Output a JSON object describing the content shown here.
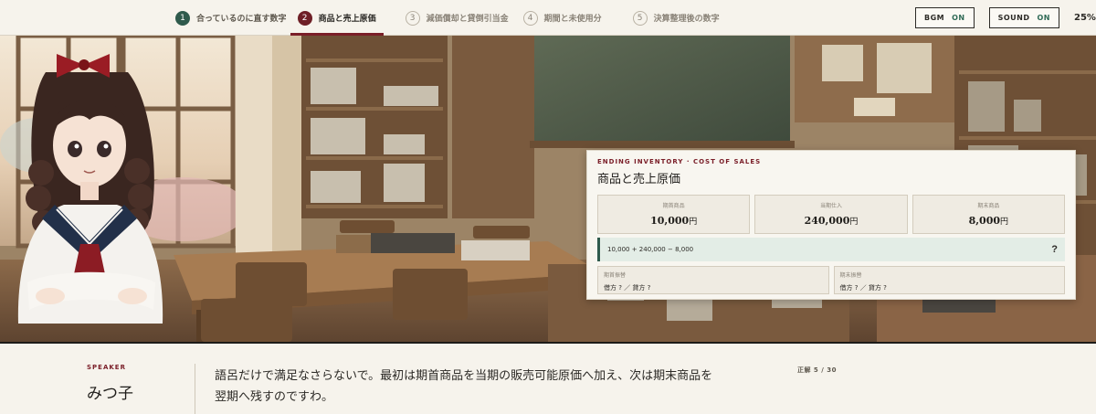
{
  "steps": [
    {
      "num": "1",
      "label": "合っているのに直す数字"
    },
    {
      "num": "2",
      "label": "商品と売上原価"
    },
    {
      "num": "3",
      "label": "減価償却と貸倒引当金"
    },
    {
      "num": "4",
      "label": "期間と未使用分"
    },
    {
      "num": "5",
      "label": "決算整理後の数字"
    }
  ],
  "toggles": {
    "bgm_label": "BGM",
    "bgm_state": "ON",
    "sound_label": "SOUND",
    "sound_state": "ON"
  },
  "progress_text": "25%",
  "card": {
    "eyebrow": "ENDING INVENTORY · COST OF SALES",
    "title": "商品と売上原価",
    "figures": [
      {
        "label": "期首商品",
        "value": "10,000",
        "unit": "円"
      },
      {
        "label": "当期仕入",
        "value": "240,000",
        "unit": "円"
      },
      {
        "label": "期末商品",
        "value": "8,000",
        "unit": "円"
      }
    ],
    "formula": "10,000 + 240,000 − 8,000",
    "formula_result": "?",
    "entries": [
      {
        "label": "期首振替",
        "value": "借方 ? ／ 貸方 ?"
      },
      {
        "label": "期末振替",
        "value": "借方 ? ／ 貸方 ?"
      }
    ]
  },
  "dialogue": {
    "speaker_eyebrow": "SPEAKER",
    "speaker": "みつ子",
    "line1": "語呂だけで満足なさらないで。最初は期首商品を当期の販売可能原価へ加え、次は期末商品を",
    "line2": "翌期へ残すのですわ。",
    "counter": "正解 5 / 30"
  },
  "colors": {
    "accent": "#7a1e28",
    "done": "#2f5a4c",
    "formula_bg": "#e3ede6"
  }
}
